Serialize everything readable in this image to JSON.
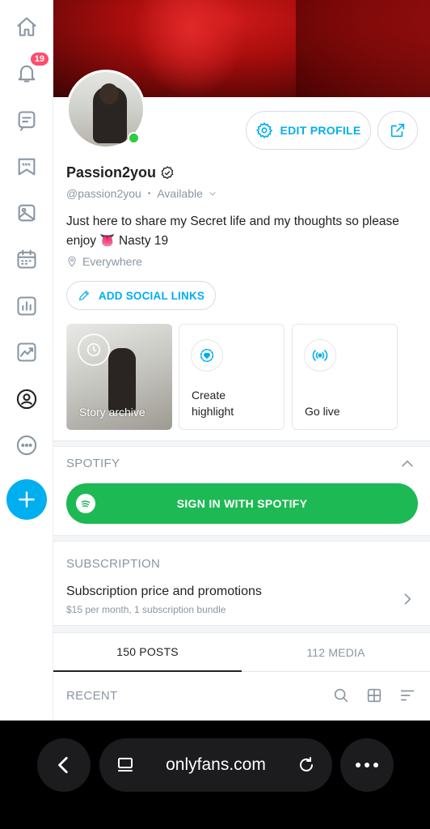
{
  "sidebar": {
    "notifications_count": "19",
    "items": [
      "home-icon",
      "bell-icon",
      "messages-icon",
      "collections-icon",
      "vault-icon",
      "calendar-icon",
      "statistics-icon",
      "analytics-icon",
      "profile-icon",
      "more-icon"
    ],
    "active_item": "profile-icon"
  },
  "profile": {
    "name": "Passion2you",
    "handle": "@passion2you",
    "status": "Available",
    "bio": "Just here to share my Secret life and my thoughts so please enjoy 👅 Nasty 19",
    "location": "Everywhere",
    "online": true
  },
  "actions": {
    "edit_profile": "EDIT PROFILE",
    "add_social_links": "ADD SOCIAL LINKS"
  },
  "stories": {
    "archive": "Story archive",
    "highlight": "Create highlight",
    "live": "Go live"
  },
  "spotify": {
    "heading": "SPOTIFY",
    "sign_in": "SIGN IN WITH SPOTIFY"
  },
  "subscription": {
    "heading": "SUBSCRIPTION",
    "title": "Subscription price and promotions",
    "description": "$15 per month, 1 subscription bundle"
  },
  "tabs": {
    "posts": "150 POSTS",
    "media": "112 MEDIA",
    "active": "posts"
  },
  "feed": {
    "recent_label": "RECENT"
  },
  "browser": {
    "url": "onlyfans.com"
  },
  "colors": {
    "accent": "#00aff0",
    "spotify_green": "#1db954",
    "badge": "#ff4d6d",
    "online": "#2ecc40"
  }
}
